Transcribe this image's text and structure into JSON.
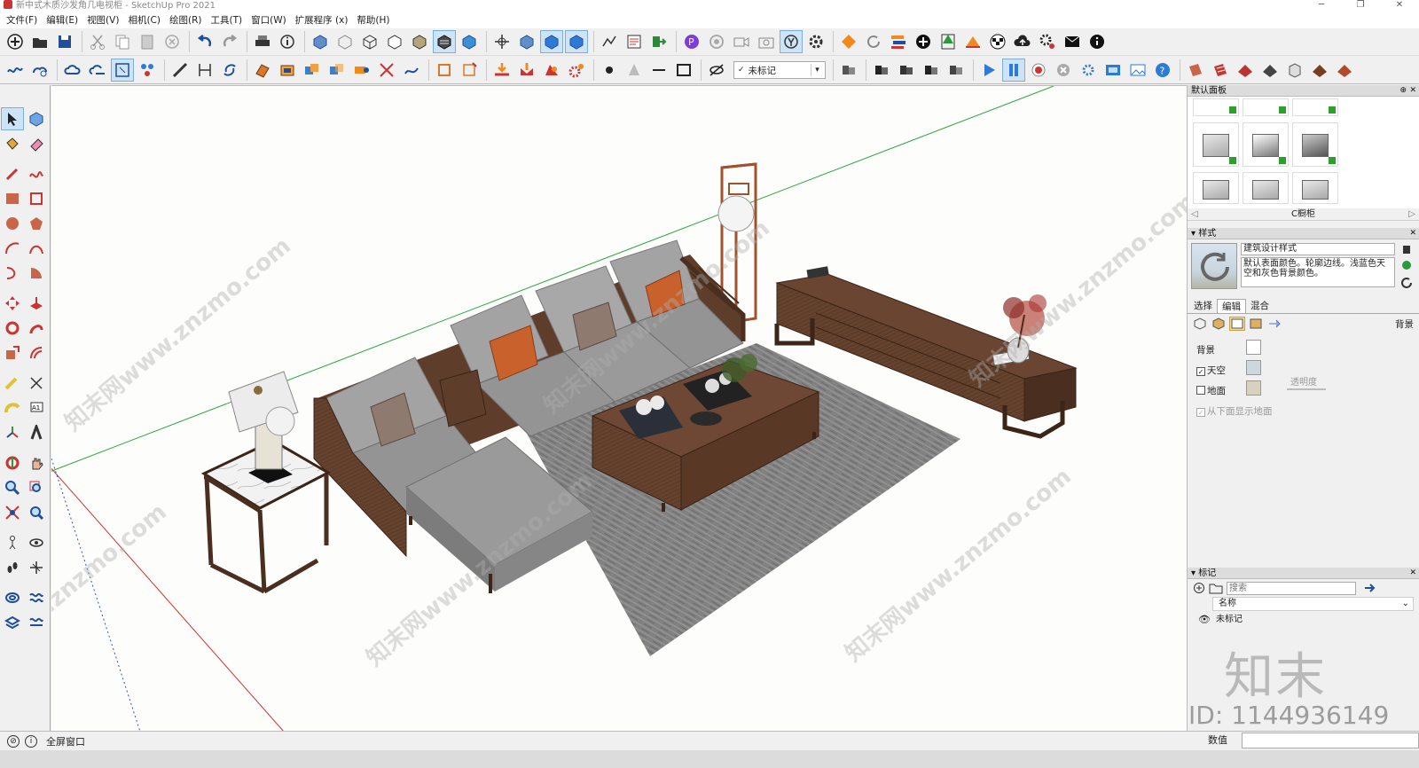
{
  "window": {
    "title": "新中式木质沙发角几电视柜 - SketchUp Pro 2021",
    "controls": [
      "─",
      "❐",
      "✕"
    ]
  },
  "menu": [
    "文件(F)",
    "编辑(E)",
    "视图(V)",
    "相机(C)",
    "绘图(R)",
    "工具(T)",
    "窗口(W)",
    "扩展程序 (x)",
    "帮助(H)"
  ],
  "toolbar": {
    "tag_select": "未标记",
    "tag_check": "✓"
  },
  "panel": {
    "title": "默认面板",
    "components": {
      "nav_label": "C橱柜",
      "prev": "◁",
      "next": "▷"
    },
    "styles": {
      "header": "样式",
      "name": "建筑设计样式",
      "description": "默认表面颜色。轮廓边线。浅蓝色天空和灰色背景颜色。",
      "tabs": [
        "选择",
        "编辑",
        "混合"
      ],
      "active_tab": "编辑",
      "section_label": "背景",
      "background_label": "背景",
      "background_color": "#ffffff",
      "sky_label": "天空",
      "sky_checked": true,
      "sky_color": "#cdd7de",
      "ground_label": "地面",
      "ground_checked": false,
      "ground_color": "#d6d2bd",
      "opacity_label": "透明度",
      "show_ground_below_label": "从下面显示地面",
      "show_ground_below_checked": true
    },
    "tags": {
      "header": "标记",
      "search_placeholder": "搜索",
      "column_name": "名称",
      "rows": [
        "未标记"
      ]
    }
  },
  "status": {
    "hint": "全屏窗口",
    "measure_label": "数值",
    "measure_value": ""
  },
  "watermarks": {
    "site": "知末网www.znzmo.com",
    "brand": "知末",
    "id": "ID: 1144936149"
  },
  "colors": {
    "accent_blue": "#2d7bd6",
    "wood": "#5e3d2a",
    "cushion": "#9a9a9a",
    "pillow_orange": "#c8612c"
  }
}
